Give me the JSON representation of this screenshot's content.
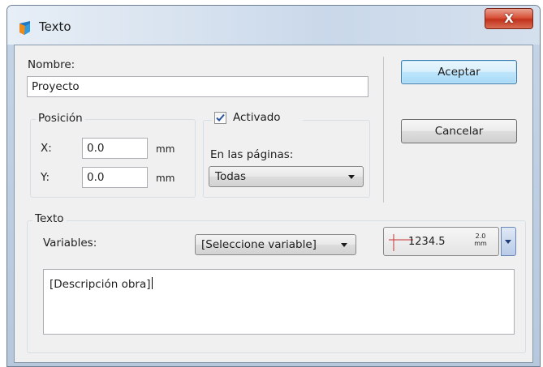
{
  "window": {
    "title": "Texto",
    "close_label": "X"
  },
  "nombre": {
    "label": "Nombre:",
    "value": "Proyecto"
  },
  "posicion": {
    "legend": "Posición",
    "x_label": "X:",
    "x_value": "0.0",
    "x_unit": "mm",
    "y_label": "Y:",
    "y_value": "0.0",
    "y_unit": "mm"
  },
  "activado": {
    "label": "Activado",
    "checked": true,
    "pages_label": "En las páginas:",
    "pages_value": "Todas"
  },
  "buttons": {
    "accept": "Aceptar",
    "cancel": "Cancelar"
  },
  "texto": {
    "legend": "Texto",
    "variables_label": "Variables:",
    "variables_value": "[Seleccione variable]",
    "style_sample": "1234.5",
    "style_size": "2.0",
    "style_unit": "mm",
    "content": "[Descripción obra]"
  },
  "colors": {
    "close_button": "#c2321c",
    "default_button_border": "#3c7fb1",
    "check_mark": "#2a52a0"
  }
}
